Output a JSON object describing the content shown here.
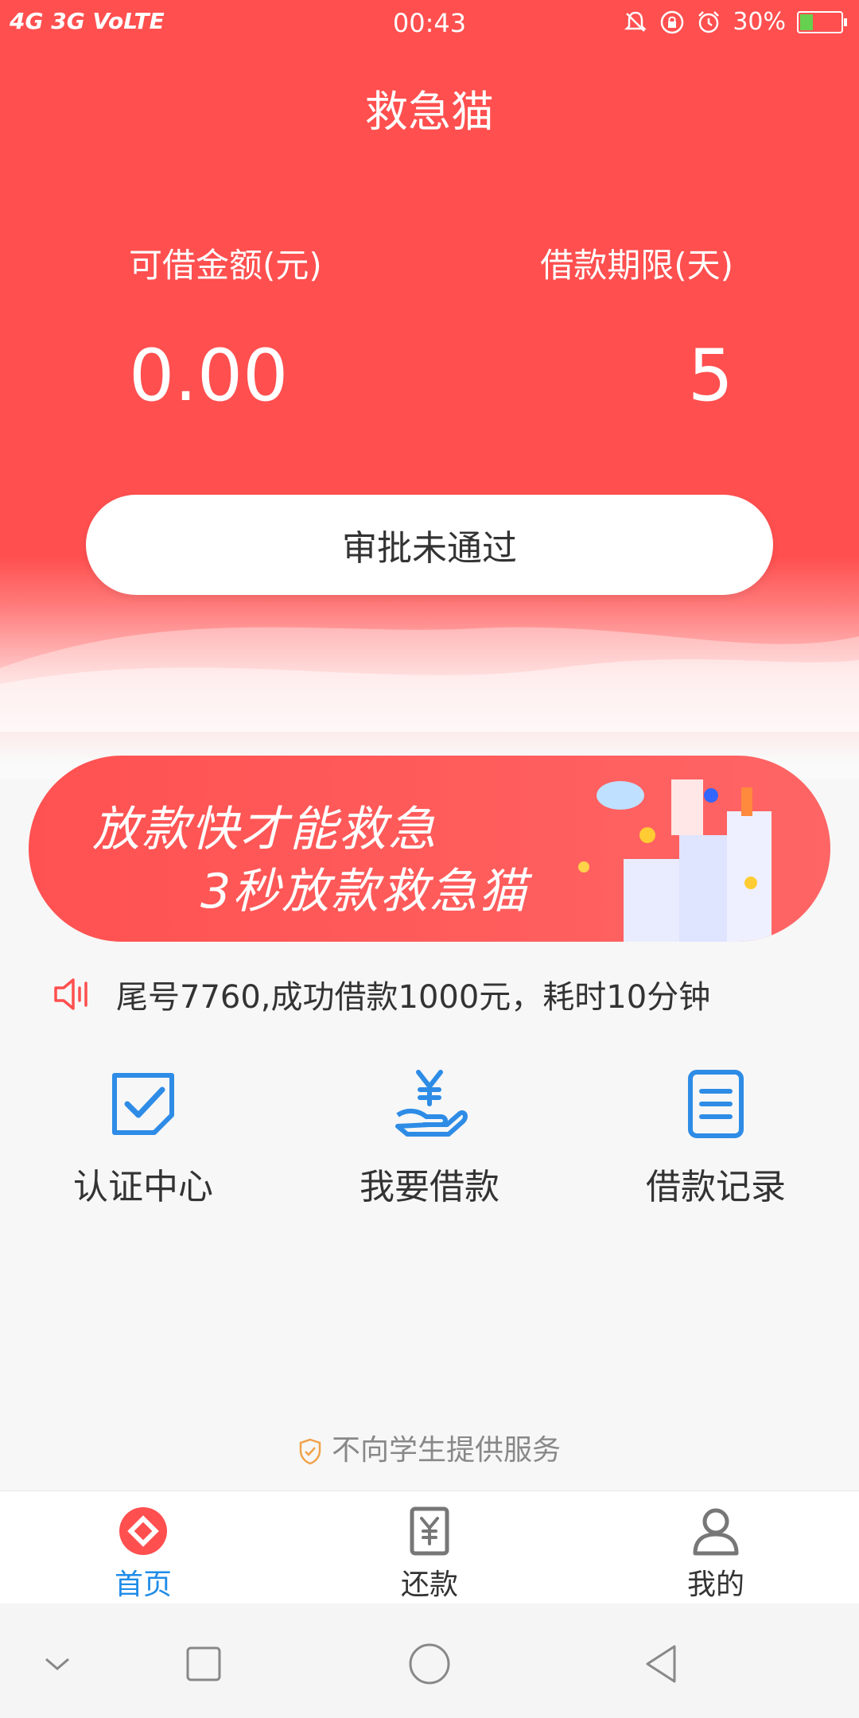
{
  "status_bar": {
    "network": "4G 3G VoLTE",
    "time": "00:43",
    "battery": "30%",
    "battery_fraction": 0.3
  },
  "app": {
    "title": "救急猫"
  },
  "summary": {
    "amount_label": "可借金额(元)",
    "amount_value": "0.00",
    "term_label": "借款期限(天)",
    "term_value": "5"
  },
  "approval_button": {
    "label": "审批未通过"
  },
  "banner": {
    "line1": "放款快才能救急",
    "line2": "3秒放款救急猫"
  },
  "notice": {
    "text": "尾号7760,成功借款1000元，耗时10分钟"
  },
  "quick_actions": [
    {
      "label": "认证中心",
      "icon": "verify-check-icon"
    },
    {
      "label": "我要借款",
      "icon": "hand-yuan-icon"
    },
    {
      "label": "借款记录",
      "icon": "list-document-icon"
    }
  ],
  "footer_note": {
    "text": "不向学生提供服务"
  },
  "tabs": [
    {
      "label": "首页",
      "icon": "home-diamond-icon",
      "active": true
    },
    {
      "label": "还款",
      "icon": "yuan-receipt-icon",
      "active": false
    },
    {
      "label": "我的",
      "icon": "user-icon",
      "active": false
    }
  ],
  "colors": {
    "brand_red": "#ff4f4f",
    "accent_blue": "#1f8ce8"
  }
}
